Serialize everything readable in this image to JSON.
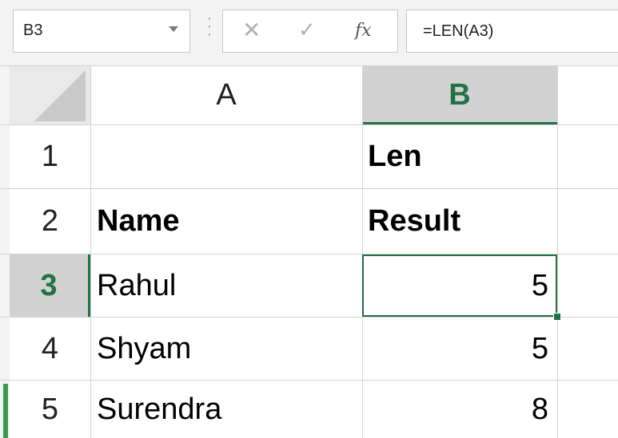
{
  "formula_bar": {
    "name_box": "B3",
    "cancel_icon": "✕",
    "enter_icon": "✓",
    "fx_label": "fx",
    "formula": "=LEN(A3)"
  },
  "columns": [
    "A",
    "B"
  ],
  "rows": [
    {
      "num": "1",
      "a": "",
      "b": "Len"
    },
    {
      "num": "2",
      "a": "Name",
      "b": "Result"
    },
    {
      "num": "3",
      "a": "Rahul",
      "b": "5"
    },
    {
      "num": "4",
      "a": "Shyam",
      "b": "5"
    },
    {
      "num": "5",
      "a": "Surendra",
      "b": "8"
    }
  ],
  "colors": {
    "accent": "#217346",
    "header_selected_bg": "#d2d2d2",
    "gridline": "#d4d4d4"
  }
}
